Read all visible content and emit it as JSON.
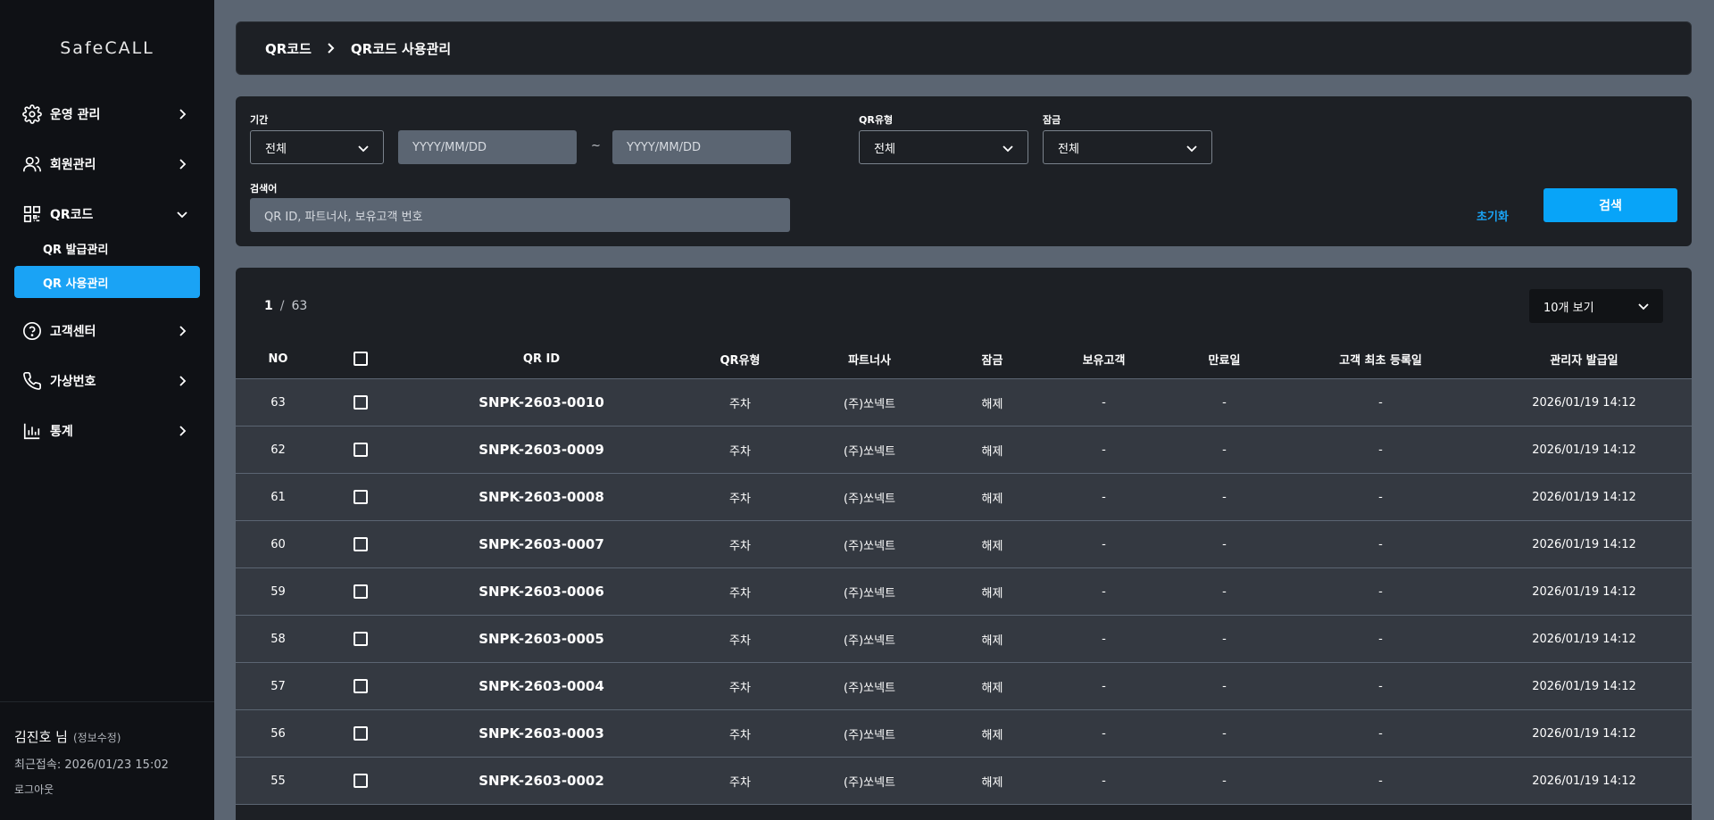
{
  "app": {
    "logo": "SafeCALL"
  },
  "sidebar": {
    "menu": [
      {
        "label": "운영 관리",
        "icon": "gear-icon"
      },
      {
        "label": "회원관리",
        "icon": "users-icon"
      },
      {
        "label": "QR코드",
        "icon": "qr-code-icon"
      },
      {
        "label": "고객센터",
        "icon": "help-circle-icon"
      },
      {
        "label": "가상번호",
        "icon": "phone-icon"
      },
      {
        "label": "통계",
        "icon": "bar-chart-icon"
      }
    ],
    "qr_sub": [
      {
        "label": "QR 발급관리"
      },
      {
        "label": "QR 사용관리"
      }
    ],
    "user": {
      "name": "김진호 님",
      "edit": "(정보수정)",
      "last_login": "최근접속: 2026/01/23 15:02",
      "logout": "로그아웃"
    }
  },
  "breadcrumb": {
    "parent": "QR코드",
    "current": "QR코드 사용관리"
  },
  "filter": {
    "period_label": "기간",
    "period_value": "전체",
    "start_placeholder": "YYYY/MM/DD",
    "tilde": "~",
    "end_placeholder": "YYYY/MM/DD",
    "qrtype_label": "QR유형",
    "qrtype_value": "전체",
    "lock_label": "잠금",
    "lock_value": "전체",
    "keyword_label": "검색어",
    "keyword_placeholder": "QR ID, 파트너사, 보유고객 번호",
    "reset_label": "초기화",
    "search_label": "검색"
  },
  "results": {
    "page": "1",
    "slash": "/",
    "total_pages": "63",
    "per_page": "10개 보기",
    "headers": {
      "no": "NO",
      "qr_id": "QR ID",
      "qr_type": "QR유형",
      "partner": "파트너사",
      "lock": "잠금",
      "customer": "보유고객",
      "expiry": "만료일",
      "first_reg": "고객 최초 등록일",
      "issued": "관리자 발급일"
    },
    "rows": [
      {
        "no": "63",
        "qr_id": "SNPK-2603-0010",
        "qr_type": "주차",
        "partner": "(주)쏘넥트",
        "lock": "해제",
        "customer": "-",
        "expiry": "-",
        "first_reg": "-",
        "issued": "2026/01/19 14:12"
      },
      {
        "no": "62",
        "qr_id": "SNPK-2603-0009",
        "qr_type": "주차",
        "partner": "(주)쏘넥트",
        "lock": "해제",
        "customer": "-",
        "expiry": "-",
        "first_reg": "-",
        "issued": "2026/01/19 14:12"
      },
      {
        "no": "61",
        "qr_id": "SNPK-2603-0008",
        "qr_type": "주차",
        "partner": "(주)쏘넥트",
        "lock": "해제",
        "customer": "-",
        "expiry": "-",
        "first_reg": "-",
        "issued": "2026/01/19 14:12"
      },
      {
        "no": "60",
        "qr_id": "SNPK-2603-0007",
        "qr_type": "주차",
        "partner": "(주)쏘넥트",
        "lock": "해제",
        "customer": "-",
        "expiry": "-",
        "first_reg": "-",
        "issued": "2026/01/19 14:12"
      },
      {
        "no": "59",
        "qr_id": "SNPK-2603-0006",
        "qr_type": "주차",
        "partner": "(주)쏘넥트",
        "lock": "해제",
        "customer": "-",
        "expiry": "-",
        "first_reg": "-",
        "issued": "2026/01/19 14:12"
      },
      {
        "no": "58",
        "qr_id": "SNPK-2603-0005",
        "qr_type": "주차",
        "partner": "(주)쏘넥트",
        "lock": "해제",
        "customer": "-",
        "expiry": "-",
        "first_reg": "-",
        "issued": "2026/01/19 14:12"
      },
      {
        "no": "57",
        "qr_id": "SNPK-2603-0004",
        "qr_type": "주차",
        "partner": "(주)쏘넥트",
        "lock": "해제",
        "customer": "-",
        "expiry": "-",
        "first_reg": "-",
        "issued": "2026/01/19 14:12"
      },
      {
        "no": "56",
        "qr_id": "SNPK-2603-0003",
        "qr_type": "주차",
        "partner": "(주)쏘넥트",
        "lock": "해제",
        "customer": "-",
        "expiry": "-",
        "first_reg": "-",
        "issued": "2026/01/19 14:12"
      },
      {
        "no": "55",
        "qr_id": "SNPK-2603-0002",
        "qr_type": "주차",
        "partner": "(주)쏘넥트",
        "lock": "해제",
        "customer": "-",
        "expiry": "-",
        "first_reg": "-",
        "issued": "2026/01/19 14:12"
      }
    ]
  },
  "colors": {
    "accent": "#1aa3f5",
    "sidebar": "#0f1115",
    "panel": "#1d2025",
    "row": "#343941",
    "page_bg": "#5b6572"
  }
}
